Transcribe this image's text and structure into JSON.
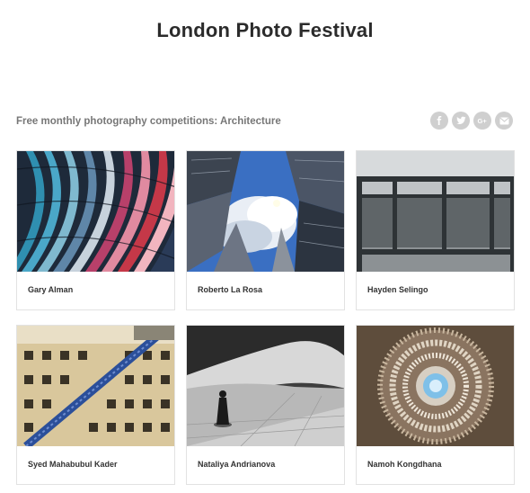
{
  "page": {
    "title": "London Photo Festival",
    "subtitle": "Free monthly photography competitions: Architecture"
  },
  "share": {
    "buttons": [
      {
        "icon": "facebook-icon",
        "glyph": "f"
      },
      {
        "icon": "twitter-icon",
        "glyph": "t"
      },
      {
        "icon": "google-plus-icon",
        "glyph": "G+"
      },
      {
        "icon": "email-icon",
        "glyph": "mail"
      }
    ],
    "color": "#cfcfcf"
  },
  "entries": [
    {
      "photographer": "Gary Alman",
      "photo": "colourful-curved-facade"
    },
    {
      "photographer": "Roberto La Rosa",
      "photo": "skyscrapers-looking-up"
    },
    {
      "photographer": "Hayden Selingo",
      "photo": "window-over-sea"
    },
    {
      "photographer": "Syed Mahabubul Kader",
      "photo": "old-building-staircase"
    },
    {
      "photographer": "Nataliya Andrianova",
      "photo": "figure-before-curved-building"
    },
    {
      "photographer": "Namoh Kongdhana",
      "photo": "crystal-chandelier-dome"
    }
  ]
}
